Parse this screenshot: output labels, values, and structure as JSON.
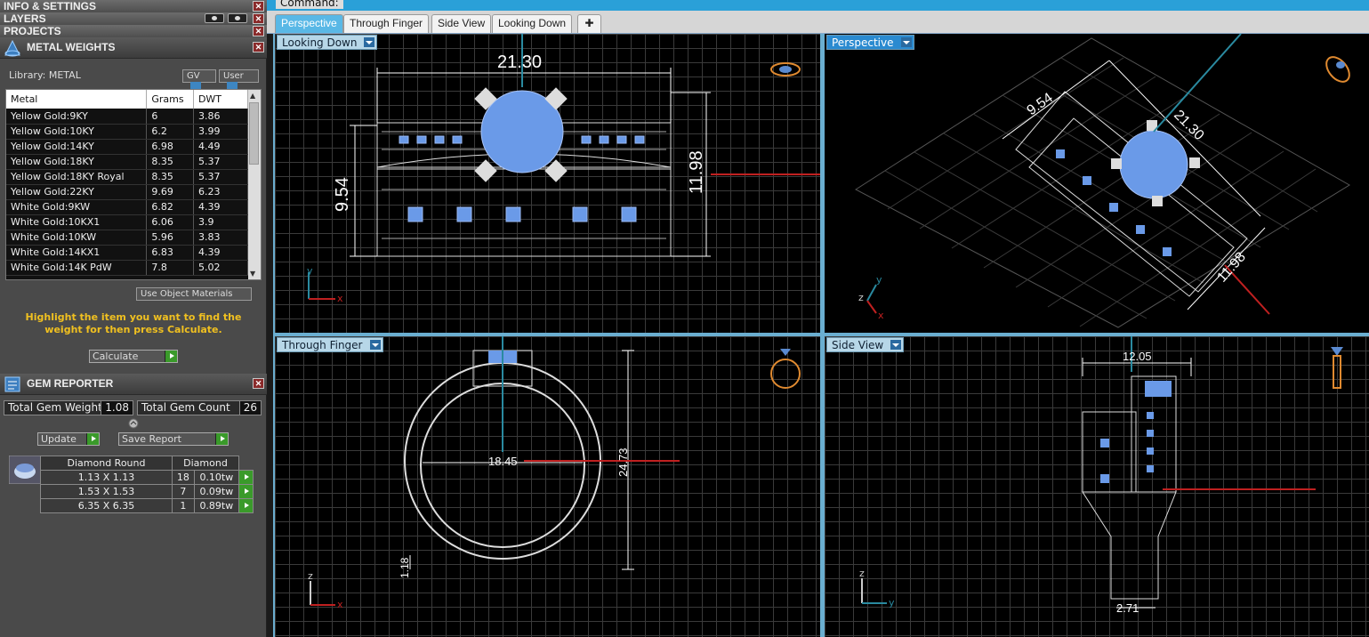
{
  "left": {
    "headers": {
      "info": "INFO & SETTINGS",
      "layers": "LAYERS",
      "projects": "PROJECTS"
    },
    "metal": {
      "title": "METAL WEIGHTS",
      "library_label": "Library: METAL",
      "gv_btn": "GV",
      "user_btn": "User",
      "columns": [
        "Metal",
        "Grams",
        "DWT"
      ],
      "rows": [
        [
          "Yellow Gold:9KY",
          "6",
          "3.86"
        ],
        [
          "Yellow Gold:10KY",
          "6.2",
          "3.99"
        ],
        [
          "Yellow Gold:14KY",
          "6.98",
          "4.49"
        ],
        [
          "Yellow Gold:18KY",
          "8.35",
          "5.37"
        ],
        [
          "Yellow Gold:18KY Royal",
          "8.35",
          "5.37"
        ],
        [
          "Yellow Gold:22KY",
          "9.69",
          "6.23"
        ],
        [
          "White Gold:9KW",
          "6.82",
          "4.39"
        ],
        [
          "White Gold:10KX1",
          "6.06",
          "3.9"
        ],
        [
          "White Gold:10KW",
          "5.96",
          "3.83"
        ],
        [
          "White Gold:14KX1",
          "6.83",
          "4.39"
        ],
        [
          "White Gold:14K PdW",
          "7.8",
          "5.02"
        ]
      ],
      "use_object_materials": "Use Object Materials",
      "hint": "Highlight the item you want to find the weight for then press Calculate.",
      "calculate": "Calculate"
    },
    "gem": {
      "title": "GEM REPORTER",
      "total_weight_label": "Total Gem Weight",
      "total_weight_value": "1.08",
      "total_count_label": "Total Gem Count",
      "total_count_value": "26",
      "update": "Update",
      "save_report": "Save Report",
      "col_shape": "Diamond Round",
      "col_type": "Diamond",
      "rows": [
        [
          "1.13 X 1.13",
          "18",
          "0.10tw"
        ],
        [
          "1.53 X 1.53",
          "7",
          "0.09tw"
        ],
        [
          "6.35 X 6.35",
          "1",
          "0.89tw"
        ]
      ]
    }
  },
  "command": {
    "label": "Command:"
  },
  "tabs": [
    "Perspective",
    "Through Finger",
    "Side View",
    "Looking Down"
  ],
  "viewports": {
    "looking_down": {
      "label": "Looking Down",
      "dims": [
        "21.30",
        "9.54",
        "11.98"
      ],
      "axes": [
        "y",
        "x"
      ]
    },
    "perspective": {
      "label": "Perspective",
      "dims": [
        "9.54",
        "21.30",
        "11.98"
      ],
      "axes": [
        "y",
        "z",
        "x"
      ]
    },
    "through_finger": {
      "label": "Through Finger",
      "dims": [
        "18.45",
        "24.73",
        "1.18"
      ],
      "axes": [
        "z",
        "x"
      ]
    },
    "side_view": {
      "label": "Side View",
      "dims": [
        "12.05",
        "2.71"
      ],
      "axes": [
        "z",
        "y"
      ]
    }
  },
  "colors": {
    "accent": "#2aa0d8",
    "gem": "#6a9ae8",
    "metal": "#e8e8e8",
    "axis_red": "#c02020",
    "axis_teal": "#2a8aa0"
  }
}
